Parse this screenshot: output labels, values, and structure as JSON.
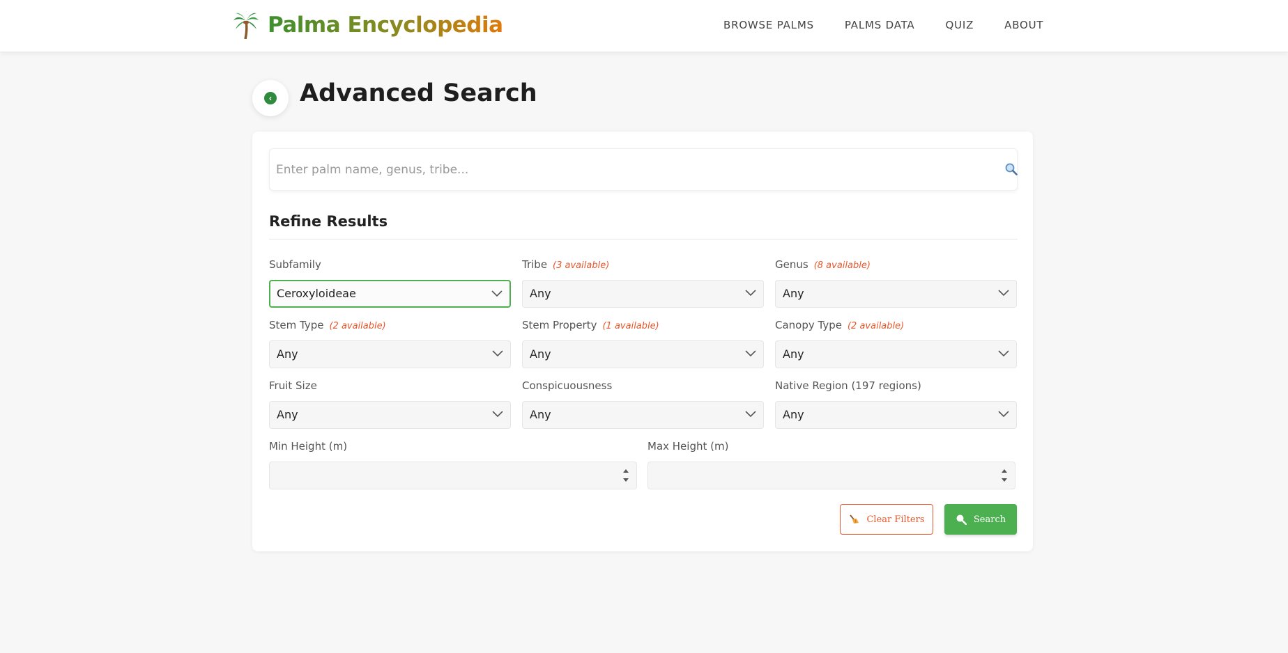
{
  "brand": {
    "title": "Palma Encyclopedia",
    "icon": "palm-tree-icon"
  },
  "nav": {
    "items": [
      "BROWSE PALMS",
      "PALMS DATA",
      "QUIZ",
      "ABOUT"
    ]
  },
  "page": {
    "title": "Advanced Search",
    "back_icon": "chevron-left-icon"
  },
  "search": {
    "placeholder": "Enter palm name, genus, tribe...",
    "icon": "search-icon"
  },
  "refine": {
    "title": "Refine Results"
  },
  "filters": {
    "subfamily": {
      "label": "Subfamily",
      "value": "Ceroxyloideae"
    },
    "tribe": {
      "label": "Tribe",
      "available": "(3 available)",
      "value": "Any"
    },
    "genus": {
      "label": "Genus",
      "available": "(8 available)",
      "value": "Any"
    },
    "stem_type": {
      "label": "Stem Type",
      "available": "(2 available)",
      "value": "Any"
    },
    "stem_property": {
      "label": "Stem Property",
      "available": "(1 available)",
      "value": "Any"
    },
    "canopy_type": {
      "label": "Canopy Type",
      "available": "(2 available)",
      "value": "Any"
    },
    "fruit_size": {
      "label": "Fruit Size",
      "value": "Any"
    },
    "conspicuousness": {
      "label": "Conspicuousness",
      "value": "Any"
    },
    "native_region": {
      "label": "Native Region (197 regions)",
      "value": "Any"
    },
    "min_height": {
      "label": "Min Height (m)",
      "value": ""
    },
    "max_height": {
      "label": "Max Height (m)",
      "value": ""
    }
  },
  "actions": {
    "clear_label": "Clear Filters",
    "clear_icon": "broom-icon",
    "search_label": "Search",
    "search_icon": "magnifier-icon"
  },
  "colors": {
    "accent_green": "#4caf50",
    "accent_orange": "#e8562a",
    "title_gradient": [
      "#3f8f2f",
      "#e07a0a"
    ]
  }
}
